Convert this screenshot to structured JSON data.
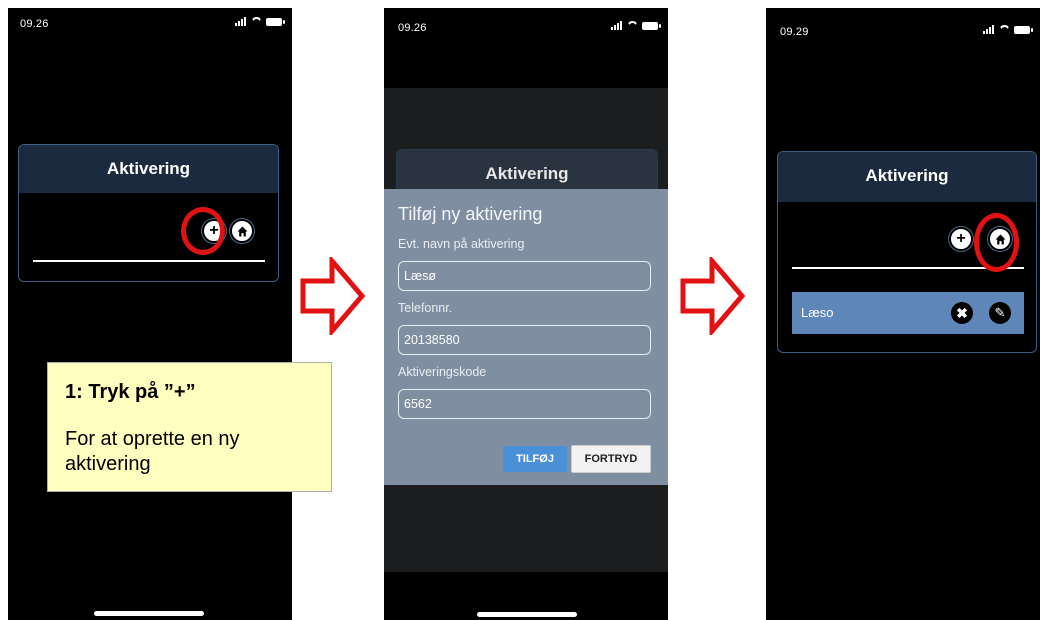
{
  "phone1": {
    "status_time": "09.26",
    "header_title": "Aktivering"
  },
  "phone2": {
    "status_time": "09.26",
    "header_title": "Aktivering",
    "dialog": {
      "title": "Tilføj ny aktivering",
      "name_label": "Evt. navn på aktivering",
      "name_value": "Læsø",
      "phone_label": "Telefonnr.",
      "phone_value": "20138580",
      "code_label": "Aktiveringskode",
      "code_value": "6562",
      "add_button": "TILFØJ",
      "cancel_button": "FORTRYD"
    }
  },
  "phone3": {
    "status_time": "09.29",
    "header_title": "Aktivering",
    "list_item": "Læso"
  },
  "callout": {
    "title": "1: Tryk på ”+”",
    "body": "For at oprette en ny aktivering"
  },
  "icons": {
    "add": "plus-icon",
    "home": "home-icon",
    "delete": "close-icon",
    "edit": "pencil-icon",
    "arrow": "right-arrow-icon"
  },
  "colors": {
    "highlight_ring": "#e31212",
    "card_header": "#1b2a3e",
    "card_border": "#3a5f86",
    "dialog_bg": "#7f8fa1",
    "list_item_bg": "#5f86b8",
    "add_button_bg": "#4a90d9",
    "callout_bg": "#ffffc0"
  }
}
